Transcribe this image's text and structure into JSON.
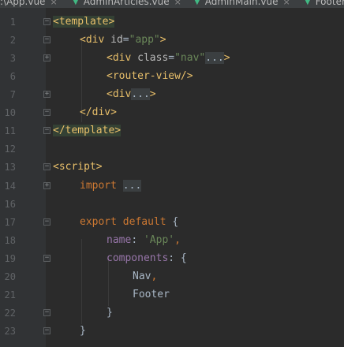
{
  "tabs": [
    {
      "label": ":\\App.vue",
      "close": "×"
    },
    {
      "label": "AdminArticles.vue",
      "close": "×"
    },
    {
      "label": "AdminMain.vue",
      "close": "×"
    },
    {
      "label": "Footer",
      "close": ""
    }
  ],
  "lines": [
    {
      "n": "1"
    },
    {
      "n": "2"
    },
    {
      "n": "3"
    },
    {
      "n": "6"
    },
    {
      "n": "7"
    },
    {
      "n": "10"
    },
    {
      "n": "11"
    },
    {
      "n": "12"
    },
    {
      "n": "13"
    },
    {
      "n": "14"
    },
    {
      "n": "16"
    },
    {
      "n": "17"
    },
    {
      "n": "18"
    },
    {
      "n": "19"
    },
    {
      "n": "20"
    },
    {
      "n": "21"
    },
    {
      "n": "22"
    },
    {
      "n": "23"
    }
  ],
  "code": {
    "l1": {
      "open": "<template>"
    },
    "l2": {
      "tag_open": "<div ",
      "attr": "id",
      "eq": "=",
      "val": "\"app\"",
      "close": ">"
    },
    "l3": {
      "tag_open": "<div ",
      "attr": "class",
      "eq": "=",
      "val": "\"nav\"",
      "dots": "...",
      "close": ">"
    },
    "l6": {
      "tag": "<router-view/>"
    },
    "l7": {
      "tag_open": "<div",
      "dots": "...",
      "close": ">"
    },
    "l10": {
      "tag": "</div>"
    },
    "l11": {
      "tag": "</template>"
    },
    "l13": {
      "tag": "<script>"
    },
    "l14": {
      "kw": "import",
      "dots": "..."
    },
    "l17": {
      "kw1": "export",
      "kw2": "default",
      "brace": "{"
    },
    "l18": {
      "prop": "name",
      "colon": ": ",
      "val": "'App'",
      "comma": ","
    },
    "l19": {
      "prop": "components",
      "rest": ": {"
    },
    "l20": {
      "ident": "Nav",
      "comma": ","
    },
    "l21": {
      "ident": "Footer"
    },
    "l22": {
      "brace": "}"
    },
    "l23": {
      "brace": "}"
    }
  },
  "colors": {
    "background": "#2b2b2b",
    "gutter": "#313335",
    "tag": "#e8bf6a",
    "keyword": "#cc7832",
    "string": "#6a8759",
    "property": "#9876aa",
    "vue_logo": "#41b883"
  }
}
